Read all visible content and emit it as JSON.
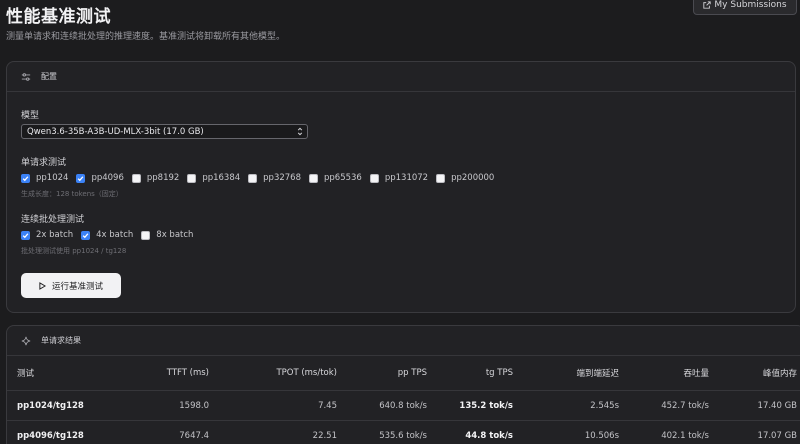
{
  "header": {
    "title": "性能基准测试",
    "subtitle": "测量单请求和连续批处理的推理速度。基准测试将卸载所有其他模型。",
    "submissions_label": "My Submissions"
  },
  "config": {
    "title": "配置",
    "model_label": "模型",
    "model_value": "Qwen3.6-35B-A3B-UD-MLX-3bit (17.0 GB)",
    "single_label": "单请求测试",
    "single_options": [
      {
        "label": "pp1024",
        "checked": true
      },
      {
        "label": "pp4096",
        "checked": true
      },
      {
        "label": "pp8192",
        "checked": false
      },
      {
        "label": "pp16384",
        "checked": false
      },
      {
        "label": "pp32768",
        "checked": false
      },
      {
        "label": "pp65536",
        "checked": false
      },
      {
        "label": "pp131072",
        "checked": false
      },
      {
        "label": "pp200000",
        "checked": false
      }
    ],
    "single_hint": "生成长度：128 tokens（固定）",
    "batch_label": "连续批处理测试",
    "batch_options": [
      {
        "label": "2x batch",
        "checked": true
      },
      {
        "label": "4x batch",
        "checked": true
      },
      {
        "label": "8x batch",
        "checked": false
      }
    ],
    "batch_hint": "批处理测试使用 pp1024 / tg128",
    "run_label": "运行基准测试"
  },
  "results": {
    "title": "单请求结果",
    "columns": [
      "测试",
      "TTFT (ms)",
      "TPOT (ms/tok)",
      "pp TPS",
      "tg TPS",
      "端到端延迟",
      "吞吐量",
      "峰值内存"
    ],
    "rows": [
      [
        "pp1024/tg128",
        "1598.0",
        "7.45",
        "640.8 tok/s",
        "135.2 tok/s",
        "2.545s",
        "452.7 tok/s",
        "17.40 GB"
      ],
      [
        "pp4096/tg128",
        "7647.4",
        "22.51",
        "535.6 tok/s",
        "44.8 tok/s",
        "10.506s",
        "402.1 tok/s",
        "17.07 GB"
      ]
    ]
  },
  "colors": {
    "accent": "#3b82f6",
    "background": "#1c1c1e",
    "card": "#222225"
  },
  "icons": {
    "submissions": "external-link-icon",
    "config": "sliders-icon",
    "results": "sparkle-icon",
    "select": "chevron-up-down-icon",
    "run": "play-icon"
  }
}
